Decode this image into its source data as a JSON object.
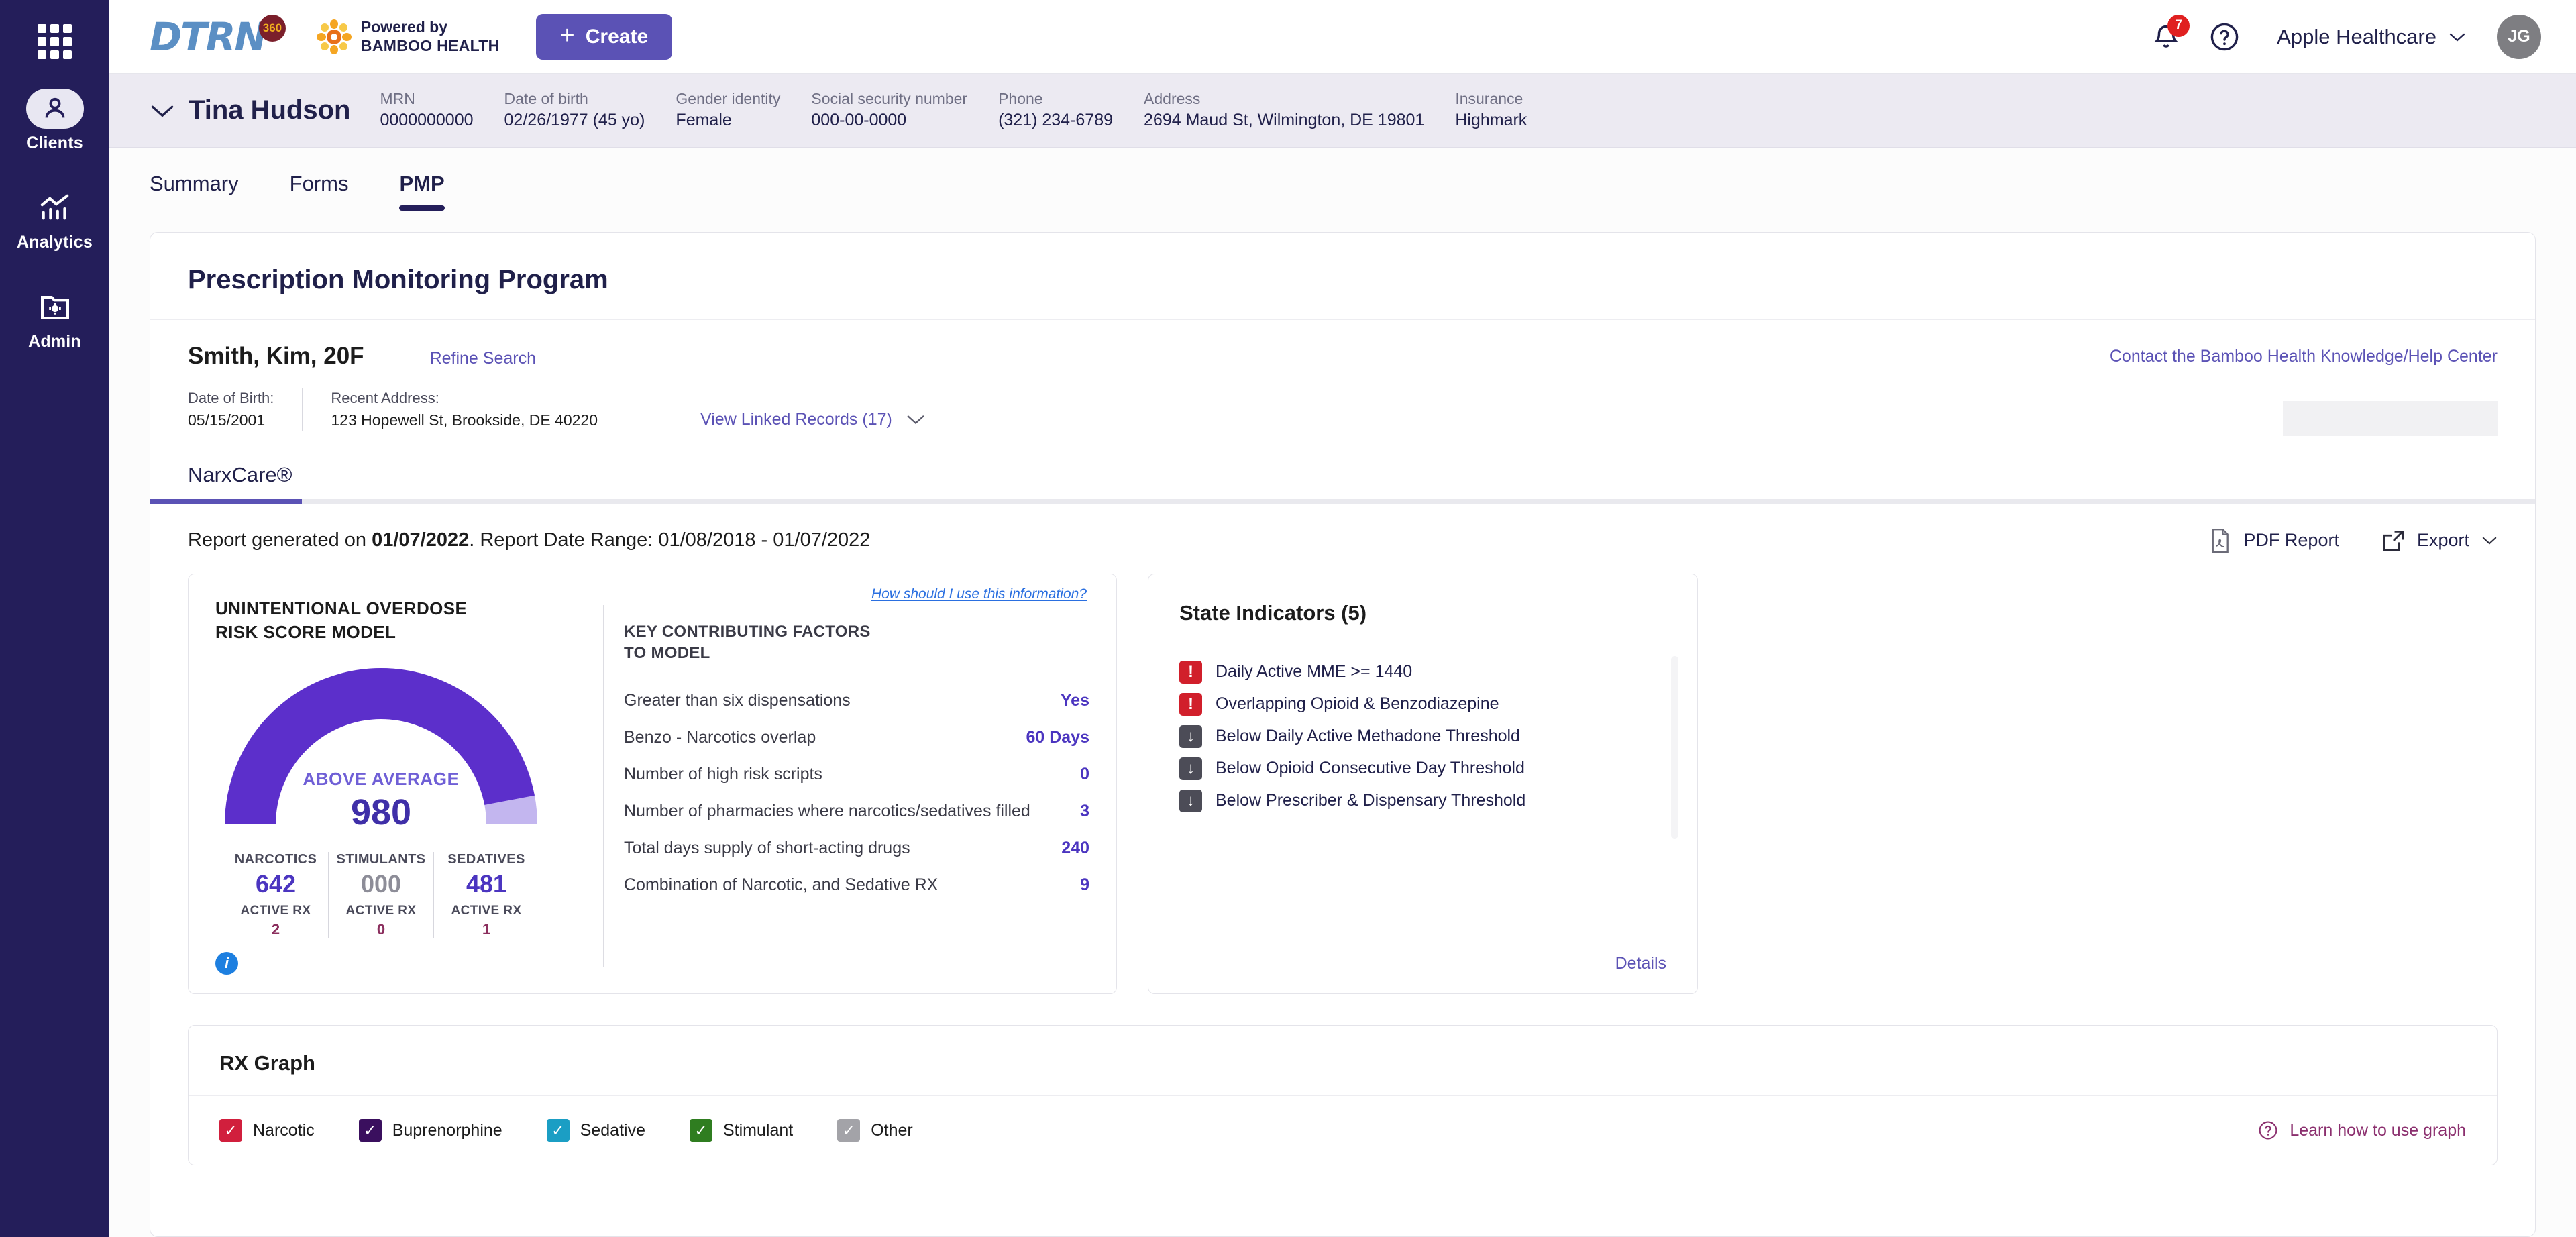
{
  "brand": {
    "logo_text": "DTRN",
    "logo_badge": "360",
    "powered_line1": "Powered by",
    "powered_line2": "BAMBOO HEALTH",
    "accent": "#5b52b5",
    "rail_bg": "#241e5a"
  },
  "topbar": {
    "create_label": "Create",
    "notification_count": "7",
    "org_name": "Apple Healthcare",
    "avatar_initials": "JG"
  },
  "patient_bar": {
    "name": "Tina Hudson",
    "fields": [
      {
        "label": "MRN",
        "value": "0000000000"
      },
      {
        "label": "Date of birth",
        "value": "02/26/1977 (45 yo)"
      },
      {
        "label": "Gender identity",
        "value": "Female"
      },
      {
        "label": "Social security number",
        "value": "000-00-0000"
      },
      {
        "label": "Phone",
        "value": "(321) 234-6789"
      },
      {
        "label": "Address",
        "value": "2694 Maud St, Wilmington, DE 19801"
      },
      {
        "label": "Insurance",
        "value": "Highmark"
      }
    ]
  },
  "sidebar": {
    "items": [
      {
        "label": "Clients",
        "icon": "person-icon",
        "active": true
      },
      {
        "label": "Analytics",
        "icon": "chart-icon",
        "active": false
      },
      {
        "label": "Admin",
        "icon": "folder-gear-icon",
        "active": false
      }
    ]
  },
  "tabs": [
    {
      "label": "Summary",
      "active": false
    },
    {
      "label": "Forms",
      "active": false
    },
    {
      "label": "PMP",
      "active": true
    }
  ],
  "pmp": {
    "title": "Prescription Monitoring Program",
    "patient_line": "Smith, Kim, 20F",
    "refine_search": "Refine Search",
    "contact_link": "Contact the Bamboo Health Knowledge/Help Center",
    "dob_label": "Date of Birth:",
    "dob_value": "05/15/2001",
    "address_label": "Recent Address:",
    "address_value": "123 Hopewell St, Brookside, DE 40220",
    "linked_records": "View Linked Records (17)",
    "subtab": "NarxCare®",
    "report_prefix": "Report generated on ",
    "report_date": "01/07/2022",
    "report_suffix": ". Report Date Range: 01/08/2018 - 01/07/2022",
    "pdf_report": "PDF Report",
    "export": "Export"
  },
  "risk_panel": {
    "title_line1": "UNINTENTIONAL OVERDOSE",
    "title_line2": "RISK SCORE MODEL",
    "how_link": "How should I use this information?",
    "gauge_label": "ABOVE AVERAGE",
    "gauge_score": "980",
    "gauge_fill_pct": 94,
    "gauge_color": "#5c2fcb",
    "stats": [
      {
        "type": "NARCOTICS",
        "number": "642",
        "active_label": "ACTIVE RX",
        "active_count": "2",
        "muted": false
      },
      {
        "type": "STIMULANTS",
        "number": "000",
        "active_label": "ACTIVE RX",
        "active_count": "0",
        "muted": true
      },
      {
        "type": "SEDATIVES",
        "number": "481",
        "active_label": "ACTIVE RX",
        "active_count": "1",
        "muted": false
      }
    ],
    "factors_title_line1": "KEY CONTRIBUTING FACTORS",
    "factors_title_line2": "TO MODEL",
    "factors": [
      {
        "label": "Greater than six dispensations",
        "value": "Yes"
      },
      {
        "label": "Benzo - Narcotics overlap",
        "value": "60 Days"
      },
      {
        "label": "Number of high risk scripts",
        "value": "0"
      },
      {
        "label": "Number of pharmacies where narcotics/sedatives filled",
        "value": "3"
      },
      {
        "label": "Total days supply of short-acting drugs",
        "value": "240"
      },
      {
        "label": "Combination of Narcotic, and Sedative RX",
        "value": "9"
      }
    ]
  },
  "state_indicators": {
    "title": "State Indicators (5)",
    "items": [
      {
        "text": "Daily Active MME >= 1440",
        "kind": "alert",
        "glyph": "!"
      },
      {
        "text": "Overlapping Opioid & Benzodiazepine",
        "kind": "alert",
        "glyph": "!"
      },
      {
        "text": "Below Daily Active Methadone Threshold",
        "kind": "below",
        "glyph": "↓"
      },
      {
        "text": "Below Opioid Consecutive Day Threshold",
        "kind": "below",
        "glyph": "↓"
      },
      {
        "text": "Below Prescriber & Dispensary Threshold",
        "kind": "below",
        "glyph": "↓"
      }
    ],
    "details": "Details"
  },
  "rx_graph": {
    "title": "RX Graph",
    "learn_link": "Learn how to use graph",
    "legend": [
      {
        "label": "Narcotic",
        "color": "#d11f3d",
        "checked": true
      },
      {
        "label": "Buprenorphine",
        "color": "#3a0f5e",
        "checked": true
      },
      {
        "label": "Sedative",
        "color": "#1b9ec4",
        "checked": true
      },
      {
        "label": "Stimulant",
        "color": "#2f7d20",
        "checked": true
      },
      {
        "label": "Other",
        "color": "#a3a3a8",
        "checked": true
      }
    ]
  }
}
